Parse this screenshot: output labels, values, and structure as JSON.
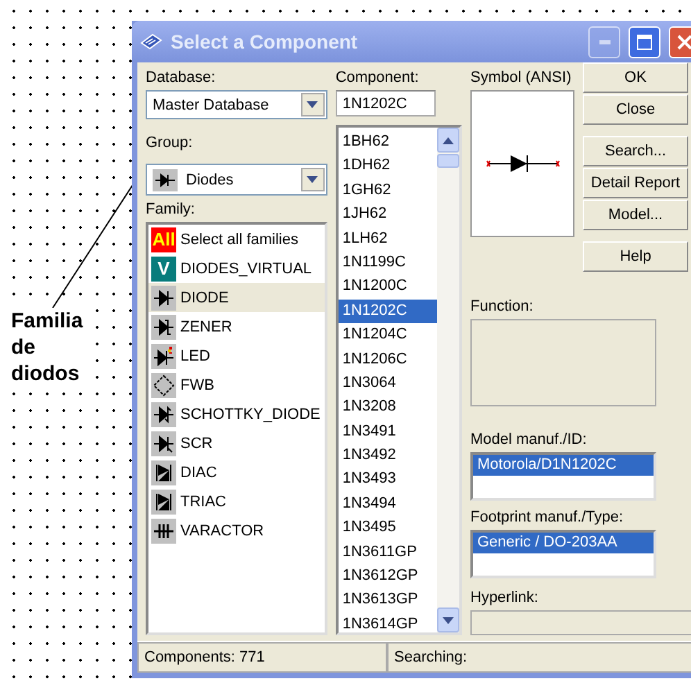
{
  "annotation": {
    "text": "Familia de diodos"
  },
  "window": {
    "title": "Select a Component"
  },
  "database": {
    "label": "Database:",
    "value": "Master Database"
  },
  "group": {
    "label": "Group:",
    "value": "Diodes"
  },
  "family": {
    "label": "Family:",
    "items": [
      {
        "label": "Select all families",
        "kind": "all",
        "badge": "All",
        "selected": false
      },
      {
        "label": "DIODES_VIRTUAL",
        "kind": "virtual",
        "badge": "V",
        "selected": false
      },
      {
        "label": "DIODE",
        "kind": "diode",
        "selected": true
      },
      {
        "label": "ZENER",
        "kind": "zener",
        "selected": false
      },
      {
        "label": "LED",
        "kind": "led",
        "selected": false
      },
      {
        "label": "FWB",
        "kind": "bridge",
        "selected": false
      },
      {
        "label": "SCHOTTKY_DIODE",
        "kind": "schottky",
        "selected": false
      },
      {
        "label": "SCR",
        "kind": "scr",
        "selected": false
      },
      {
        "label": "DIAC",
        "kind": "diac",
        "selected": false
      },
      {
        "label": "TRIAC",
        "kind": "triac",
        "selected": false
      },
      {
        "label": "VARACTOR",
        "kind": "varactor",
        "selected": false
      }
    ]
  },
  "component": {
    "label": "Component:",
    "value": "1N1202C",
    "items": [
      {
        "label": "1BH62",
        "selected": false
      },
      {
        "label": "1DH62",
        "selected": false
      },
      {
        "label": "1GH62",
        "selected": false
      },
      {
        "label": "1JH62",
        "selected": false
      },
      {
        "label": "1LH62",
        "selected": false
      },
      {
        "label": "1N1199C",
        "selected": false
      },
      {
        "label": "1N1200C",
        "selected": false
      },
      {
        "label": "1N1202C",
        "selected": true
      },
      {
        "label": "1N1204C",
        "selected": false
      },
      {
        "label": "1N1206C",
        "selected": false
      },
      {
        "label": "1N3064",
        "selected": false
      },
      {
        "label": "1N3208",
        "selected": false
      },
      {
        "label": "1N3491",
        "selected": false
      },
      {
        "label": "1N3492",
        "selected": false
      },
      {
        "label": "1N3493",
        "selected": false
      },
      {
        "label": "1N3494",
        "selected": false
      },
      {
        "label": "1N3495",
        "selected": false
      },
      {
        "label": "1N3611GP",
        "selected": false
      },
      {
        "label": "1N3612GP",
        "selected": false
      },
      {
        "label": "1N3613GP",
        "selected": false
      },
      {
        "label": "1N3614GP",
        "selected": false
      }
    ]
  },
  "symbol": {
    "label": "Symbol (ANSI)"
  },
  "button_groups": [
    [
      "OK",
      "Close"
    ],
    [
      "Search...",
      "Detail Report",
      "Model..."
    ],
    [
      "Help"
    ]
  ],
  "function": {
    "label": "Function:"
  },
  "model": {
    "label": "Model manuf./ID:",
    "items": [
      {
        "label": "Motorola/D1N1202C",
        "selected": true
      }
    ]
  },
  "footprint": {
    "label": "Footprint manuf./Type:",
    "items": [
      {
        "label": "Generic / DO-203AA",
        "selected": true
      }
    ]
  },
  "hyperlink": {
    "label": "Hyperlink:"
  },
  "status_bar": [
    "Components: 771",
    "Searching:"
  ]
}
